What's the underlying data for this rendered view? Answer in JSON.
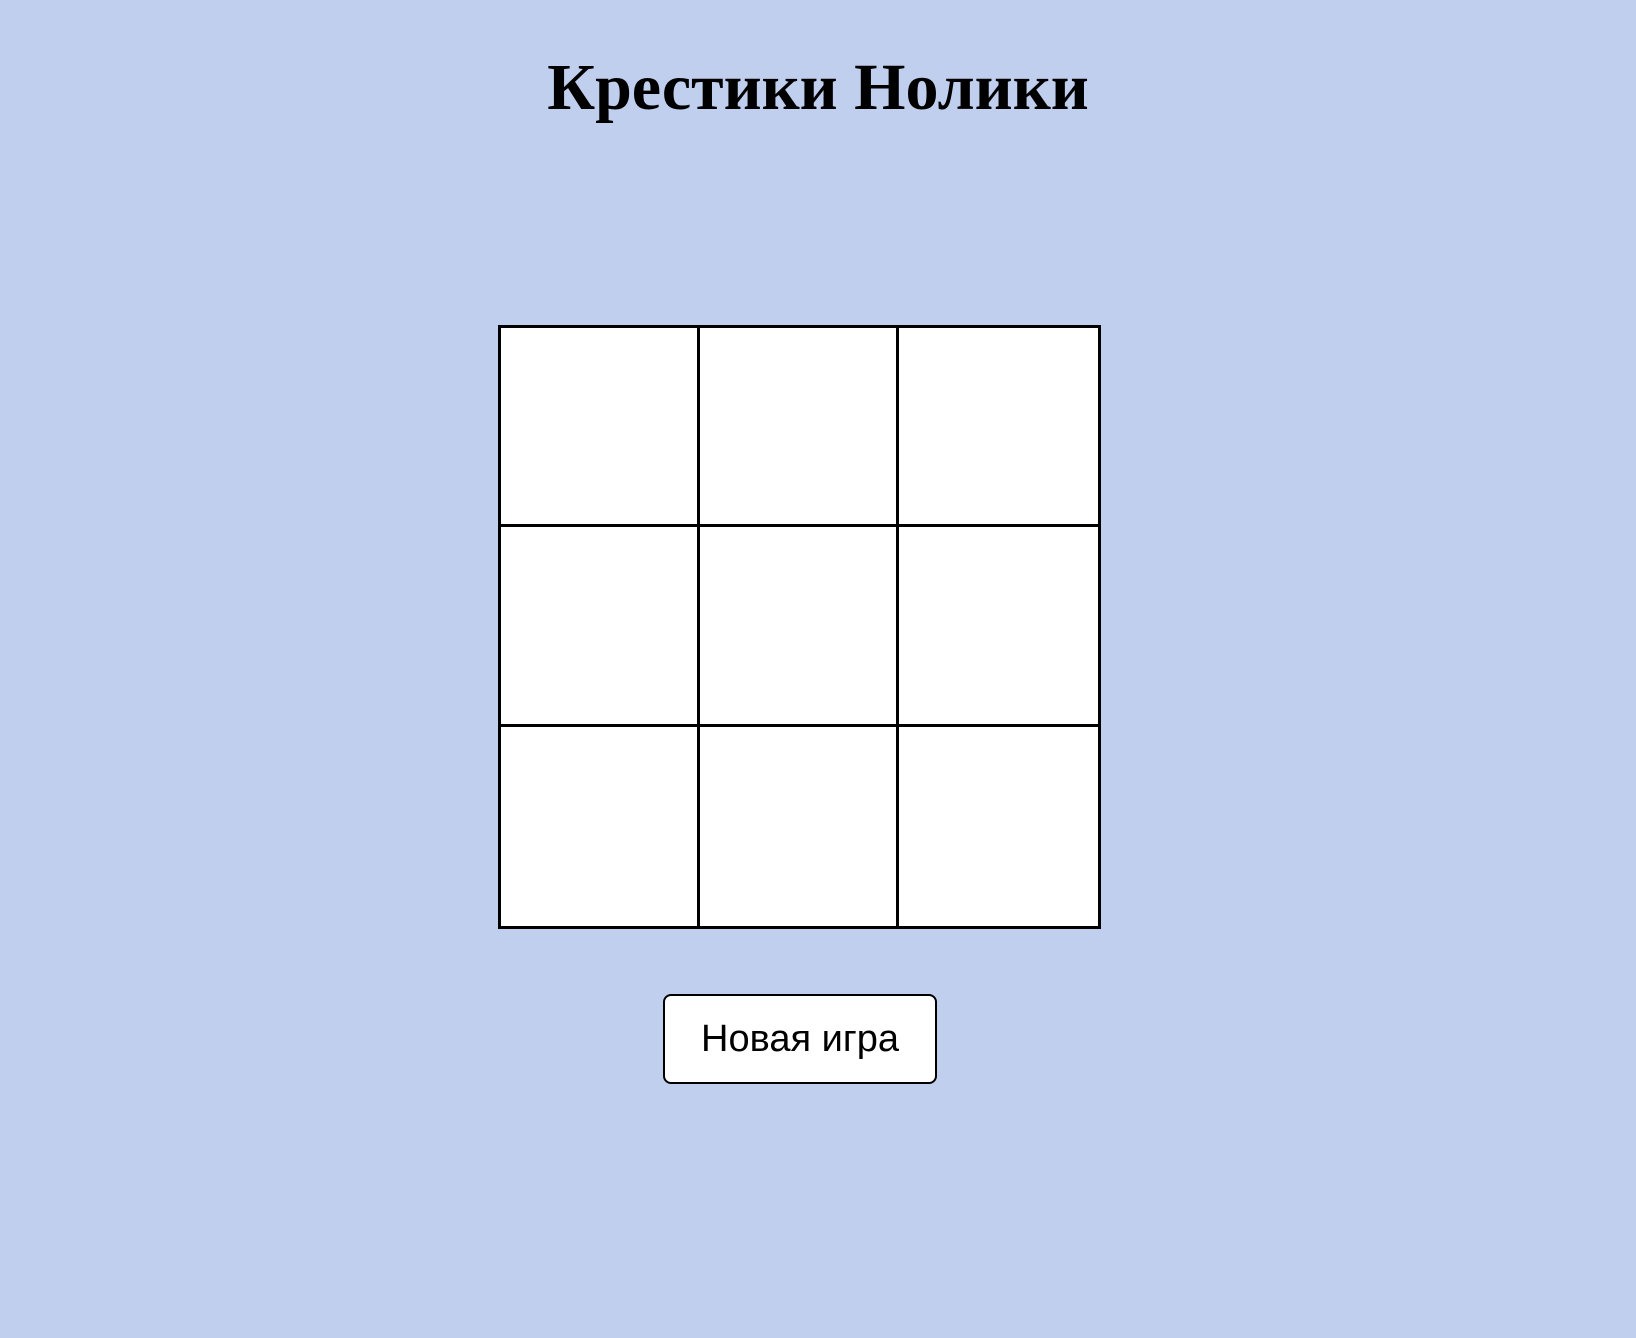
{
  "page": {
    "title": "Крестики Нолики",
    "background_color": "#c1cfef"
  },
  "board": {
    "cells": [
      "",
      "",
      "",
      "",
      "",
      "",
      "",
      "",
      ""
    ]
  },
  "controls": {
    "new_game_label": "Новая игра"
  }
}
